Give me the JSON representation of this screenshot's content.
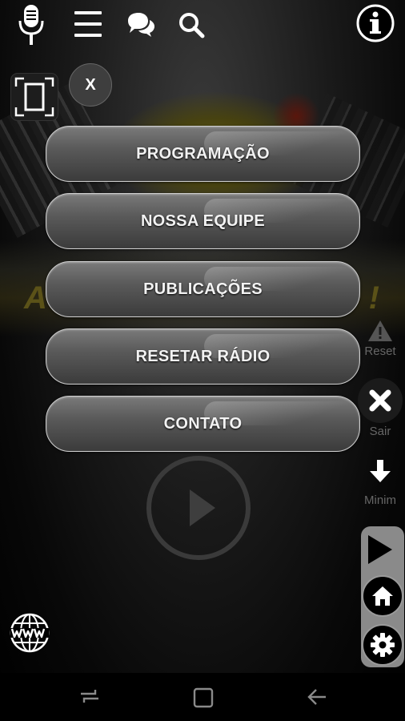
{
  "background": {
    "banner_left_glyph": "A",
    "banner_right_glyph": "!"
  },
  "toolbar": {
    "icons": [
      "microphone-icon",
      "hamburger-menu-icon",
      "chat-bubbles-icon",
      "search-icon",
      "info-icon"
    ]
  },
  "panel": {
    "close_label": "X"
  },
  "menu": {
    "items": [
      {
        "label": "PROGRAMAÇÃO"
      },
      {
        "label": "NOSSA EQUIPE"
      },
      {
        "label": "PUBLICAÇÕES"
      },
      {
        "label": "RESETAR RÁDIO"
      },
      {
        "label": "CONTATO"
      }
    ]
  },
  "side": {
    "reset_label": "Reset",
    "exit_label": "Sair",
    "minimize_label": "Minim"
  },
  "colors": {
    "menu_text": "#f2f2f2",
    "side_label": "#666666",
    "dock": "#8a8a8a",
    "logo_yellow": "#5b5218"
  }
}
